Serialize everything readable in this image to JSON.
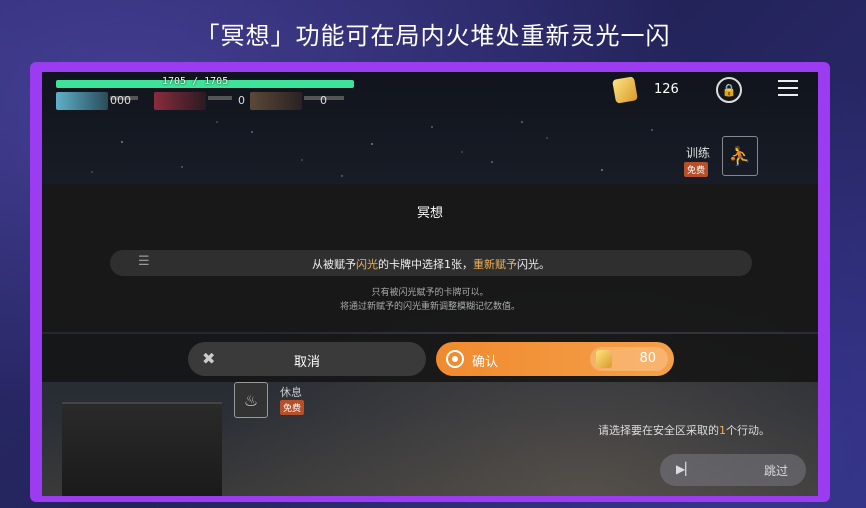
{
  "headline": "「冥想」功能可在局内火堆处重新灵光一闪",
  "hud": {
    "hp_text": "1705 / 1705",
    "hp_fraction": 1.0,
    "party": [
      {
        "name": "portrait-1",
        "value": "000"
      },
      {
        "name": "portrait-2",
        "value": "0"
      },
      {
        "name": "portrait-3",
        "value": "0"
      }
    ],
    "currency_value": "126",
    "lock_icon": "lock-icon",
    "menu_icon": "hamburger-menu-icon"
  },
  "training": {
    "label": "训练",
    "tag": "免费",
    "icon": "exercise-bike-icon"
  },
  "dialog": {
    "title": "冥想",
    "instruction_pre": "从被赋予",
    "instruction_hl1": "闪光",
    "instruction_mid": "的卡牌中选择1张，",
    "instruction_hl2": "重新赋予",
    "instruction_post": "闪光。",
    "note1": "只有被闪光赋予的卡牌可以。",
    "note2": "将通过新赋予的闪光重新调整模糊记忆数值。"
  },
  "buttons": {
    "cancel_label": "取消",
    "confirm_label": "确认",
    "confirm_cost": "80"
  },
  "scene": {
    "rest_label": "休息",
    "rest_tag": "免费",
    "prompt_pre": "请选择要在安全区采取的",
    "prompt_num": "1",
    "prompt_post": "个行动。",
    "skip_label": "跳过"
  },
  "colors": {
    "frame": "#9b3cf0",
    "confirm": "#f08a2e",
    "highlight": "#f0b25a",
    "hp": "#3ee39a"
  }
}
